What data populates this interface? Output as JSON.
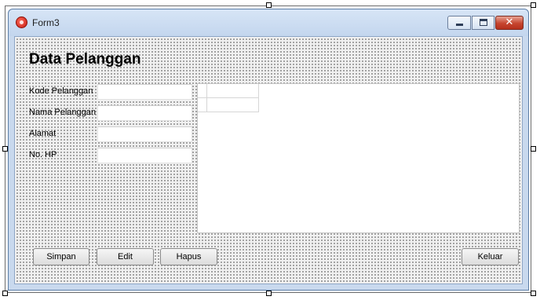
{
  "window": {
    "title": "Form3",
    "controls": {
      "minimize": "minimize",
      "maximize": "maximize",
      "close": "✕"
    }
  },
  "form": {
    "heading": "Data Pelanggan",
    "fields": [
      {
        "label": "Kode Pelanggan",
        "value": ""
      },
      {
        "label": "Nama Pelanggan",
        "value": ""
      },
      {
        "label": "Alamat",
        "value": ""
      },
      {
        "label": "No. HP",
        "value": ""
      }
    ],
    "buttons": {
      "simpan": "Simpan",
      "edit": "Edit",
      "hapus": "Hapus",
      "keluar": "Keluar"
    }
  },
  "colors": {
    "title_bar": "#c9d9ee",
    "client_background": "#f0f0f0",
    "close_button": "#c6452f"
  }
}
